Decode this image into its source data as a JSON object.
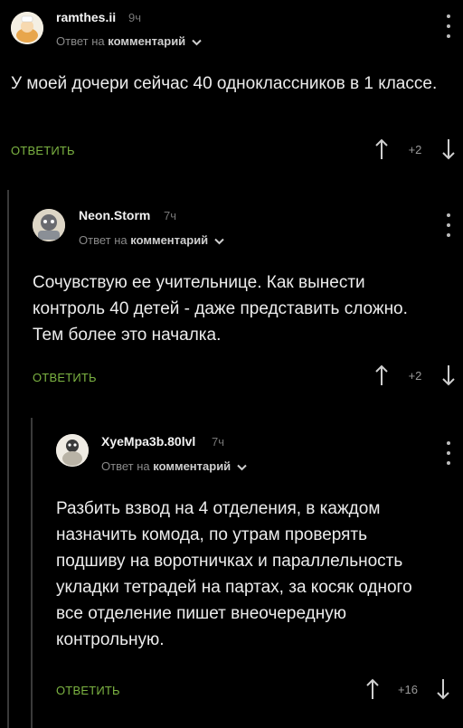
{
  "comments": [
    {
      "username": "ramthes.ii",
      "time": "9ч",
      "reply_prefix": "Ответ на",
      "reply_target": "комментарий",
      "text": "У моей дочери сейчас 40 одноклассников в 1 классе.",
      "reply_label": "ОТВЕТИТЬ",
      "score": "+2"
    },
    {
      "username": "Neon.Storm",
      "time": "7ч",
      "reply_prefix": "Ответ на",
      "reply_target": "комментарий",
      "text": "Сочувствую ее учительнице. Как вынести контроль 40 детей - даже представить сложно. Тем более это началка.",
      "reply_label": "ОТВЕТИТЬ",
      "score": "+2"
    },
    {
      "username": "XyeMpa3b.80lvl",
      "time": "7ч",
      "reply_prefix": "Ответ на",
      "reply_target": "комментарий",
      "text": "Разбить взвод на 4 отделения, в каждом назначить комода, по утрам проверять подшиву на воротничках и параллельность укладки тетрадей на партах, за косяк одного все отделение пишет внеочередную контрольную.",
      "reply_label": "ОТВЕТИТЬ",
      "score": "+16"
    }
  ],
  "colors": {
    "background": "#000000",
    "reply_button": "#7cb342",
    "thread_line": "#3a3a3a"
  },
  "icons": [
    "more-vertical-icon",
    "chevron-down-icon",
    "arrow-up-icon",
    "arrow-down-icon"
  ]
}
